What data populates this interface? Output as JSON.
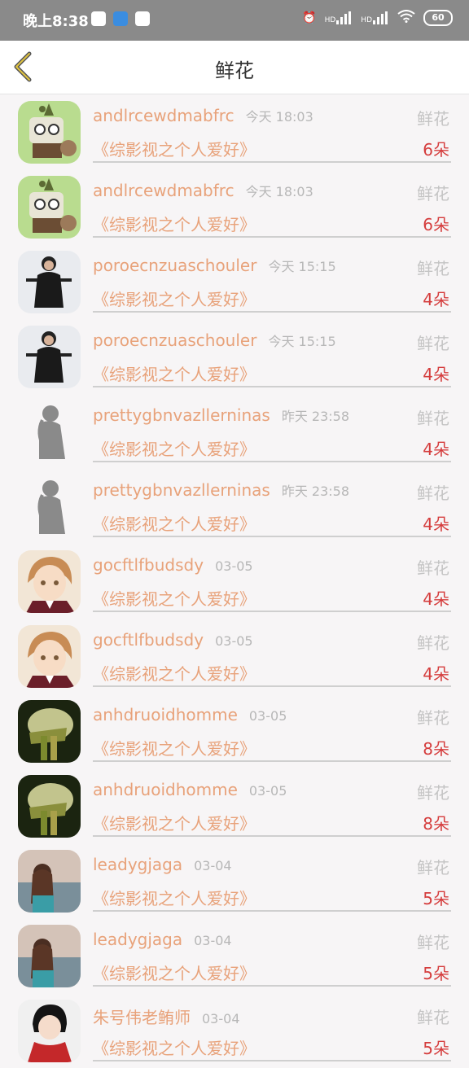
{
  "status_bar": {
    "time": "晚上8:38",
    "battery": "60",
    "hd1": "HD",
    "hd2": "HD"
  },
  "header": {
    "title": "鲜花",
    "back_icon": "chevron-left-icon"
  },
  "items": [
    {
      "username": "andlrcewdmabfrc",
      "time": "今天 18:03",
      "type": "鲜花",
      "book": "《综影视之个人爱好》",
      "count": "6朵",
      "avatar": "robot"
    },
    {
      "username": "andlrcewdmabfrc",
      "time": "今天 18:03",
      "type": "鲜花",
      "book": "《综影视之个人爱好》",
      "count": "6朵",
      "avatar": "robot"
    },
    {
      "username": "poroecnzuaschouler",
      "time": "今天 15:15",
      "type": "鲜花",
      "book": "《综影视之个人爱好》",
      "count": "4朵",
      "avatar": "girl-dark"
    },
    {
      "username": "poroecnzuaschouler",
      "time": "今天 15:15",
      "type": "鲜花",
      "book": "《综影视之个人爱好》",
      "count": "4朵",
      "avatar": "girl-dark"
    },
    {
      "username": "prettygbnvazllerninas",
      "time": "昨天 23:58",
      "type": "鲜花",
      "book": "《综影视之个人爱好》",
      "count": "4朵",
      "avatar": "silhouette"
    },
    {
      "username": "prettygbnvazllerninas",
      "time": "昨天 23:58",
      "type": "鲜花",
      "book": "《综影视之个人爱好》",
      "count": "4朵",
      "avatar": "silhouette"
    },
    {
      "username": "gocftlfbudsdy",
      "time": "03-05",
      "type": "鲜花",
      "book": "《综影视之个人爱好》",
      "count": "4朵",
      "avatar": "anime"
    },
    {
      "username": "gocftlfbudsdy",
      "time": "03-05",
      "type": "鲜花",
      "book": "《综影视之个人爱好》",
      "count": "4朵",
      "avatar": "anime"
    },
    {
      "username": "anhdruoidhomme",
      "time": "03-05",
      "type": "鲜花",
      "book": "《综影视之个人爱好》",
      "count": "8朵",
      "avatar": "scarf"
    },
    {
      "username": "anhdruoidhomme",
      "time": "03-05",
      "type": "鲜花",
      "book": "《综影视之个人爱好》",
      "count": "8朵",
      "avatar": "scarf"
    },
    {
      "username": "leadygjaga",
      "time": "03-04",
      "type": "鲜花",
      "book": "《综影视之个人爱好》",
      "count": "5朵",
      "avatar": "sea-girl"
    },
    {
      "username": "leadygjaga",
      "time": "03-04",
      "type": "鲜花",
      "book": "《综影视之个人爱好》",
      "count": "5朵",
      "avatar": "sea-girl"
    },
    {
      "username": "朱号伟老鲔师",
      "time": "03-04",
      "type": "鲜花",
      "book": "《综影视之个人爱好》",
      "count": "5朵",
      "avatar": "red-scarf"
    }
  ]
}
